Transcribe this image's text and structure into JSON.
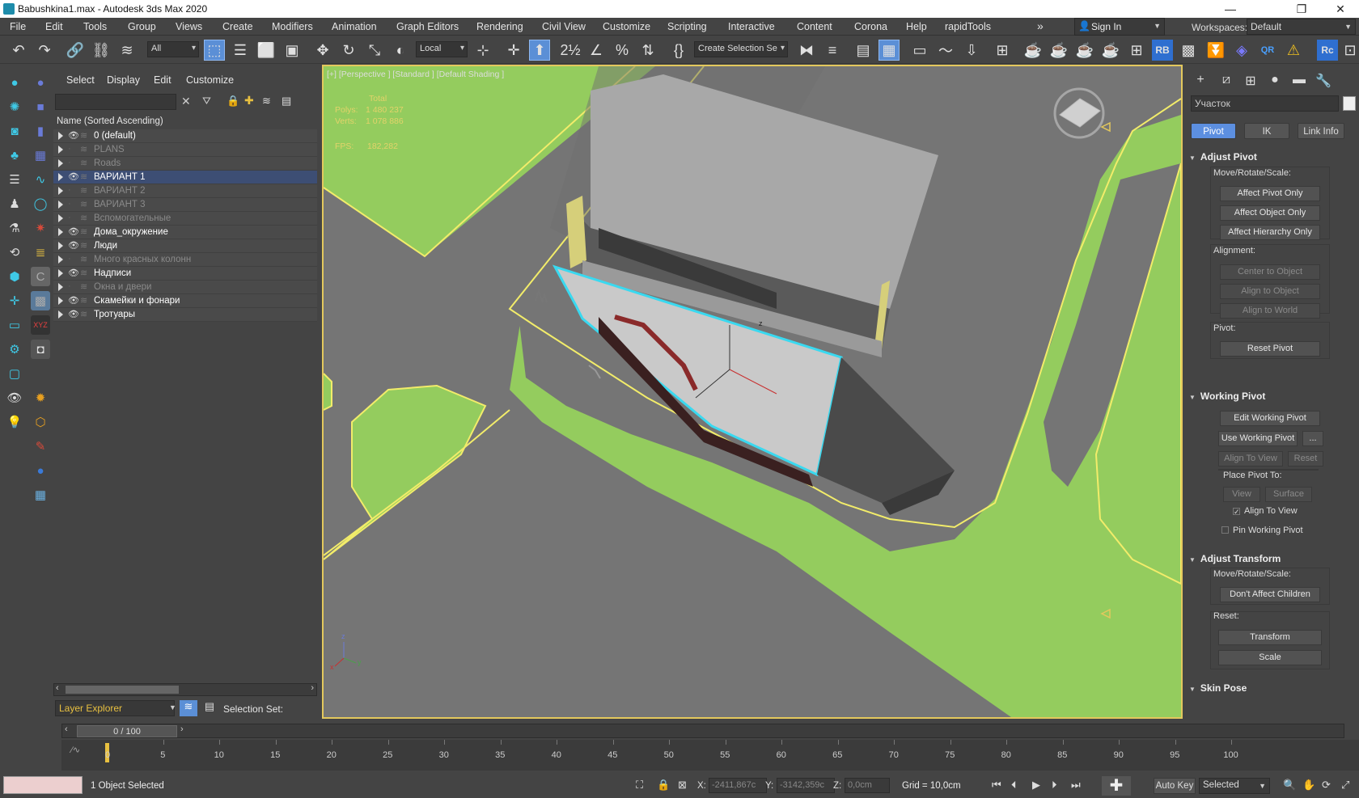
{
  "window": {
    "title": "Babushkina1.max - Autodesk 3ds Max 2020",
    "minimize": "—",
    "restore": "❐",
    "close": "✕"
  },
  "menu": [
    "File",
    "Edit",
    "Tools",
    "Group",
    "Views",
    "Create",
    "Modifiers",
    "Animation",
    "Graph Editors",
    "Rendering",
    "Civil View",
    "Customize",
    "Scripting",
    "Interactive",
    "Content",
    "Corona",
    "Help",
    "rapidTools"
  ],
  "menu_overflow": "»",
  "signin": "Sign In",
  "workspaces": {
    "label": "Workspaces:",
    "value": "Default"
  },
  "toolbar": {
    "selection_filter": "All",
    "ref_coord": "Local",
    "named_selection": "Create Selection Se"
  },
  "explorer": {
    "tabs": [
      "Select",
      "Display",
      "Edit",
      "Customize"
    ],
    "column_header": "Name (Sorted Ascending)",
    "rows": [
      {
        "name": "0 (default)",
        "visible": true,
        "dim": false,
        "selected": false
      },
      {
        "name": "PLANS",
        "visible": false,
        "dim": true,
        "selected": false
      },
      {
        "name": "Roads",
        "visible": false,
        "dim": true,
        "selected": false
      },
      {
        "name": "ВАРИАНТ 1",
        "visible": true,
        "dim": false,
        "selected": true
      },
      {
        "name": "ВАРИАНТ 2",
        "visible": false,
        "dim": true,
        "selected": false
      },
      {
        "name": "ВАРИАНТ 3",
        "visible": false,
        "dim": true,
        "selected": false
      },
      {
        "name": "Вспомогательные",
        "visible": false,
        "dim": true,
        "selected": false
      },
      {
        "name": "Дома_окружение",
        "visible": true,
        "dim": false,
        "selected": false
      },
      {
        "name": "Люди",
        "visible": true,
        "dim": false,
        "selected": false
      },
      {
        "name": "Много красных колонн",
        "visible": false,
        "dim": true,
        "selected": false
      },
      {
        "name": "Надписи",
        "visible": true,
        "dim": false,
        "selected": false
      },
      {
        "name": "Окна и двери",
        "visible": false,
        "dim": true,
        "selected": false
      },
      {
        "name": "Скамейки и фонари",
        "visible": true,
        "dim": false,
        "selected": false
      },
      {
        "name": "Тротуары",
        "visible": true,
        "dim": false,
        "selected": false
      }
    ],
    "layer_explorer": "Layer Explorer",
    "selection_set_label": "Selection Set:"
  },
  "viewport": {
    "label": "[+] [Perspective ] [Standard ] [Default Shading ]",
    "stats": {
      "total_label": "Total",
      "polys_label": "Polys:",
      "polys_value": "1 480 237",
      "verts_label": "Verts:",
      "verts_value": "1 078 886",
      "fps_label": "FPS:",
      "fps_value": "182,282"
    },
    "gizmo_z": "z",
    "axis_z": "z",
    "axis_x": "x",
    "axis_y": "y"
  },
  "command_panel": {
    "object_name": "Участок",
    "tabs": [
      "Pivot",
      "IK",
      "Link Info"
    ],
    "adjust_pivot": {
      "title": "Adjust Pivot",
      "move_label": "Move/Rotate/Scale:",
      "buttons": [
        "Affect Pivot Only",
        "Affect Object Only",
        "Affect Hierarchy Only"
      ],
      "alignment_label": "Alignment:",
      "align_buttons": [
        "Center to Object",
        "Align to Object",
        "Align to World"
      ],
      "pivot_label": "Pivot:",
      "reset_pivot": "Reset Pivot"
    },
    "working_pivot": {
      "title": "Working Pivot",
      "edit": "Edit Working Pivot",
      "use": "Use Working Pivot",
      "more": "...",
      "align_to_view": "Align To View",
      "reset": "Reset",
      "place_label": "Place Pivot To:",
      "view": "View",
      "surface": "Surface",
      "align_to_view_chk": "Align To View",
      "pin": "Pin Working Pivot"
    },
    "adjust_transform": {
      "title": "Adjust Transform",
      "move_label": "Move/Rotate/Scale:",
      "dont_affect": "Don't Affect Children",
      "reset_label": "Reset:",
      "transform": "Transform",
      "scale": "Scale"
    },
    "skin_pose": {
      "title": "Skin Pose"
    }
  },
  "timeline": {
    "slider": "0 / 100",
    "ticks": [
      "5",
      "10",
      "15",
      "20",
      "25",
      "30",
      "35",
      "40",
      "45",
      "50",
      "55",
      "60",
      "65",
      "70",
      "75",
      "80",
      "85",
      "90",
      "95",
      "100"
    ],
    "zero": "0"
  },
  "status": {
    "selection": "1 Object Selected",
    "x_label": "X:",
    "x_value": "-2411,867c",
    "y_label": "Y:",
    "y_value": "-3142,359c",
    "z_label": "Z:",
    "z_value": "0,0cm",
    "grid": "Grid = 10,0cm",
    "autokey": "Auto Key",
    "selected_dd": "Selected"
  },
  "colors": {
    "grass": "#94cc5e",
    "road": "#767676",
    "outline": "#f2ec6a",
    "selection": "#39d9f0",
    "selected_row": "#3d4e74",
    "active_tab": "#5c8fe0"
  }
}
